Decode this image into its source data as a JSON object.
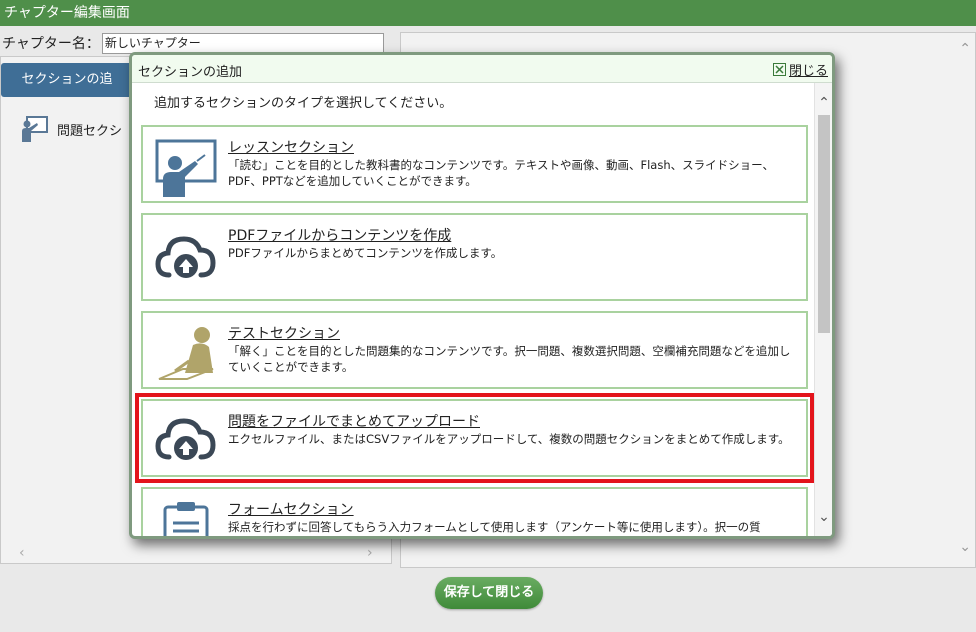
{
  "window": {
    "title": "チャプター編集画面"
  },
  "chapter": {
    "name_label": "チャプター名：",
    "name_value": "新しいチャプター"
  },
  "left_pane": {
    "add_section_button": "セクションの追",
    "tree_item_label": "問題セクシ"
  },
  "footer": {
    "save_close_label": "保存して閉じる"
  },
  "dialog": {
    "title": "セクションの追加",
    "close_label": "閉じる",
    "instruction": "追加するセクションのタイプを選択してください。",
    "cards": [
      {
        "title": "レッスンセクション",
        "icon": "lesson-teacher-icon",
        "description": "「読む」ことを目的とした教科書的なコンテンツです。テキストや画像、動画、Flash、スライドショー、PDF、PPTなどを追加していくことができます。"
      },
      {
        "title": "PDFファイルからコンテンツを作成",
        "icon": "cloud-upload-icon",
        "description": "PDFファイルからまとめてコンテンツを作成します。"
      },
      {
        "title": "テストセクション",
        "icon": "test-writing-icon",
        "description": "「解く」ことを目的とした問題集的なコンテンツです。択一問題、複数選択問題、空欄補充問題などを追加していくことができます。"
      },
      {
        "title": "問題をファイルでまとめてアップロード",
        "icon": "cloud-upload-icon",
        "description": "エクセルファイル、またはCSVファイルをアップロードして、複数の問題セクションをまとめて作成します。"
      },
      {
        "title": "フォームセクション",
        "icon": "form-clipboard-icon",
        "description": "採点を行わずに回答してもらう入力フォームとして使用します（アンケート等に使用します）。択一の質"
      }
    ]
  },
  "colors": {
    "header_green": "#4f8f4a",
    "card_border": "#a9d29f",
    "highlight_red": "#e3141b",
    "button_blue": "#3f6e96"
  }
}
